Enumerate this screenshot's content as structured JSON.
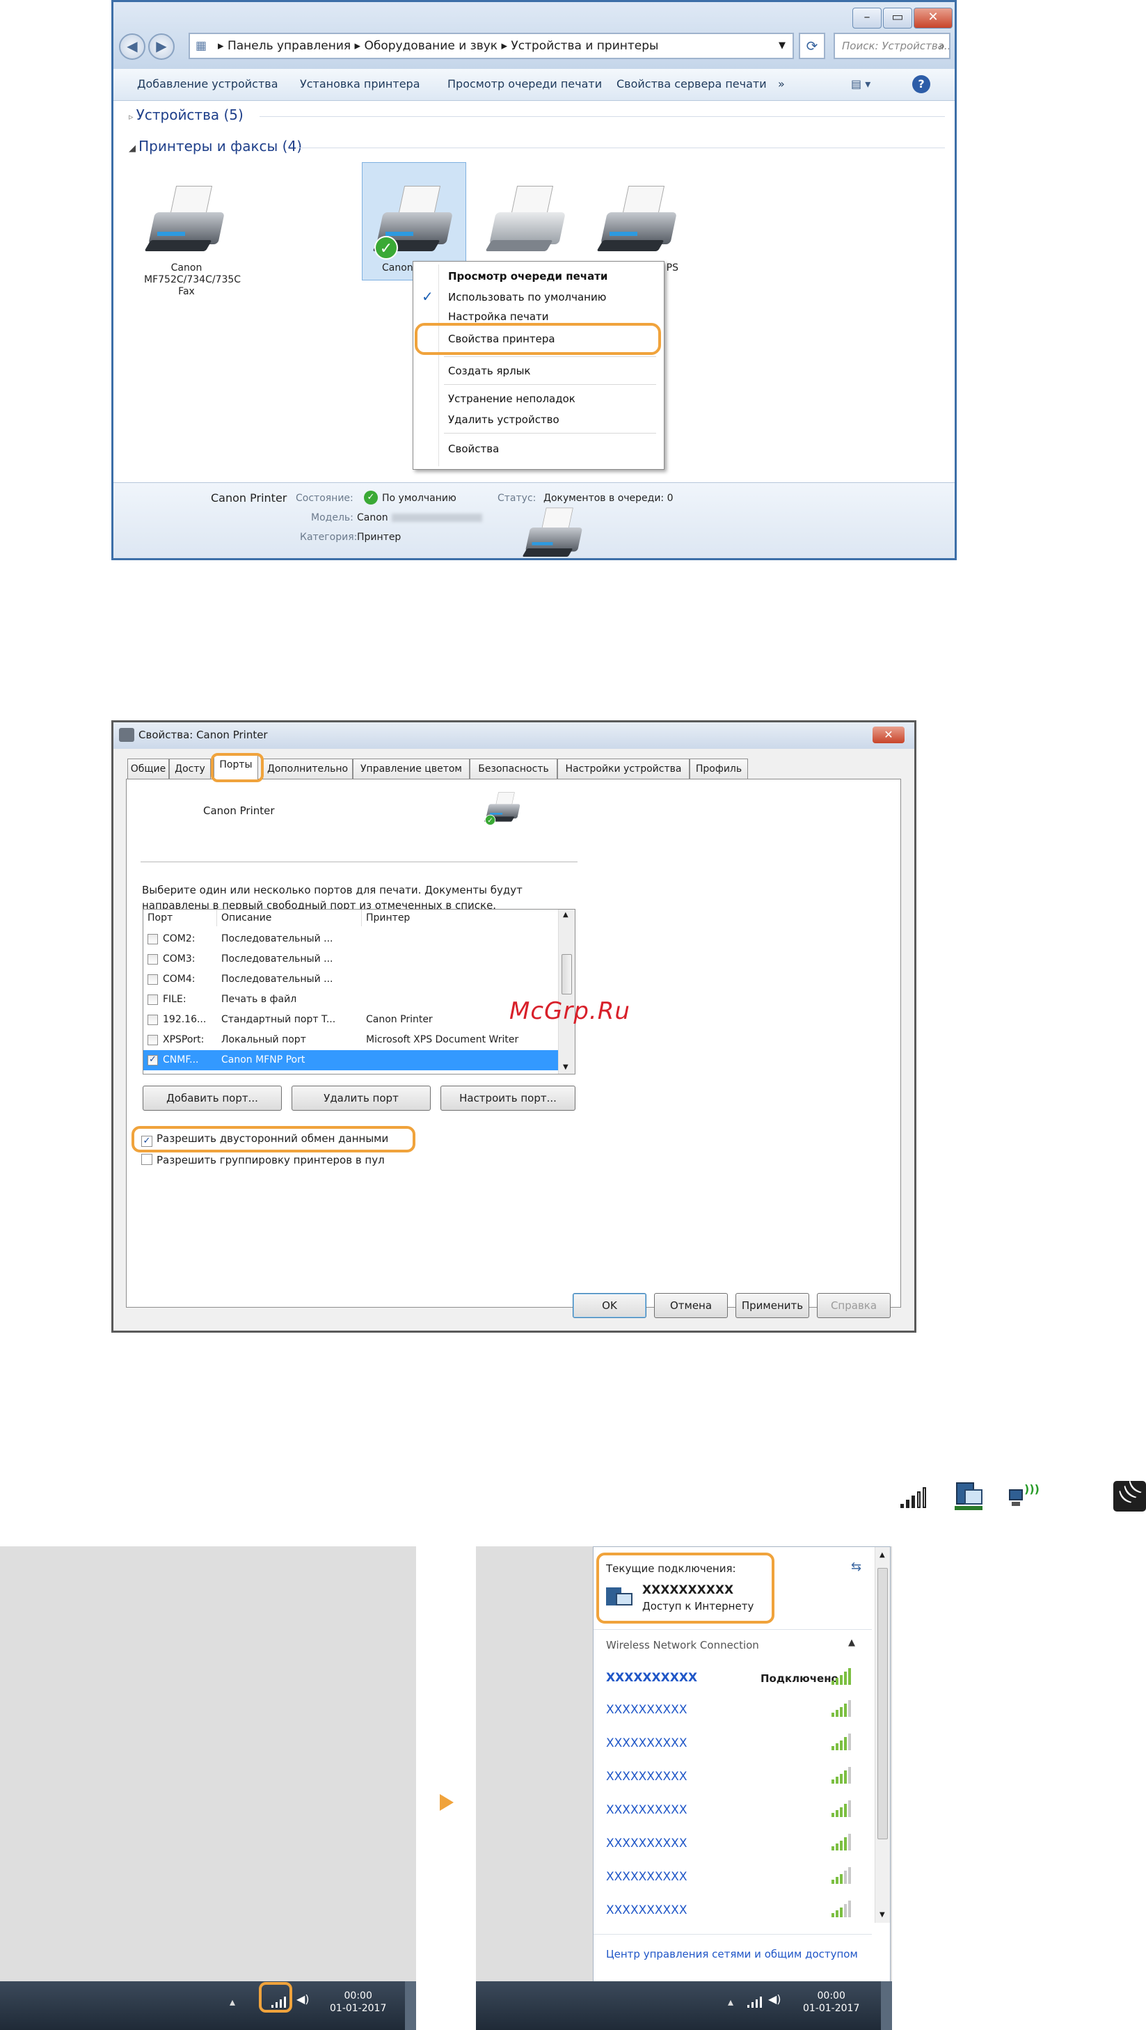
{
  "window1": {
    "address_parts": [
      "Панель управления",
      "Оборудование и звук",
      "Устройства и принтеры"
    ],
    "search_placeholder": "Поиск: Устройства...",
    "commands": [
      "Добавление устройства",
      "Установка принтера",
      "Просмотр очереди печати",
      "Свойства сервера печати",
      "»"
    ],
    "group_devices": "Устройства (5)",
    "group_printers": "Принтеры и факсы (4)",
    "devices": [
      {
        "label": "Canon MF752C/734C/735C Fax"
      },
      {
        "label": "Canon"
      },
      {
        "label": ""
      },
      {
        "label": "PS"
      }
    ],
    "context_menu": [
      {
        "label": "Просмотр очереди печати",
        "bold": true
      },
      {
        "label": "Использовать по умолчанию",
        "checked": true
      },
      {
        "label": "Настройка печати"
      },
      {
        "label": "Свойства принтера",
        "highlighted": true
      },
      {
        "label": "Создать ярлык"
      },
      {
        "label": "Устранение неполадок"
      },
      {
        "label": "Удалить устройство"
      },
      {
        "label": "Свойства"
      }
    ],
    "details": {
      "name": "Canon Printer",
      "state_key": "Состояние:",
      "state_val": "По умолчанию",
      "status_key": "Статус:",
      "status_val": "Документов в очереди: 0",
      "model_key": "Модель:",
      "model_val": "Canon",
      "category_key": "Категория:",
      "category_val": "Принтер"
    }
  },
  "window2": {
    "title": "Свойства: Canon Printer",
    "tabs": [
      "Общие",
      "Досту",
      "Порты",
      "Дополнительно",
      "Управление цветом",
      "Безопасность",
      "Настройки устройства",
      "Профиль"
    ],
    "active_tab": "Порты",
    "printer_name": "Canon Printer",
    "instructions_1": "Выберите один или несколько портов для печати. Документы будут",
    "instructions_2": "направлены в первый свободный порт из отмеченных в списке.",
    "col_port": "Порт",
    "col_desc": "Описание",
    "col_printer": "Принтер",
    "ports": [
      {
        "port": "COM2:",
        "desc": "Последовательный ...",
        "printer": "",
        "checked": false
      },
      {
        "port": "COM3:",
        "desc": "Последовательный ...",
        "printer": "",
        "checked": false
      },
      {
        "port": "COM4:",
        "desc": "Последовательный ...",
        "printer": "",
        "checked": false
      },
      {
        "port": "FILE:",
        "desc": "Печать в файл",
        "printer": "",
        "checked": false
      },
      {
        "port": "192.16...",
        "desc": "Стандартный порт T...",
        "printer": "Canon Printer",
        "checked": false
      },
      {
        "port": "XPSPort:",
        "desc": "Локальный порт",
        "printer": "Microsoft XPS Document Writer",
        "checked": false
      },
      {
        "port": "CNMF...",
        "desc": "Canon MFNP Port",
        "printer": "",
        "checked": true,
        "selected": true
      }
    ],
    "btn_add": "Добавить порт...",
    "btn_delete": "Удалить порт",
    "btn_configure": "Настроить порт...",
    "bidi_label": "Разрешить двусторонний обмен данными",
    "bidi_checked": true,
    "pool_label": "Разрешить группировку принтеров в пул",
    "pool_checked": false,
    "btn_ok": "OK",
    "btn_cancel": "Отмена",
    "btn_apply": "Применить",
    "btn_help": "Справка"
  },
  "watermark": "McGrp.Ru",
  "network": {
    "current_heading": "Текущие подключения:",
    "current_name": "XXXXXXXXXX",
    "current_status": "Доступ к Интернету",
    "section": "Wireless Network Connection",
    "connected_name": "XXXXXXXXXX",
    "connected_label": "Подключено",
    "networks": [
      "XXXXXXXXXX",
      "XXXXXXXXXX",
      "XXXXXXXXXX",
      "XXXXXXXXXX",
      "XXXXXXXXXX",
      "XXXXXXXXXX",
      "XXXXXXXXXX"
    ],
    "footer_link": "Центр управления сетями и общим доступом",
    "clock_time": "00:00",
    "clock_date": "01-01-2017"
  }
}
